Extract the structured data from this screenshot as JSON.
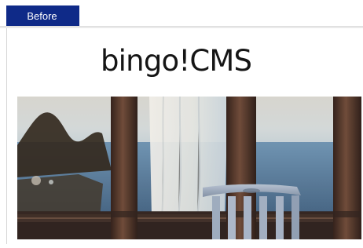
{
  "tab": {
    "label": "Before"
  },
  "brand": {
    "logo_text": "bingo!CMS"
  },
  "hero": {
    "icon": "window-chair-photo",
    "colors": {
      "wood": "#5a3b2a",
      "sky": "#c9d5d8",
      "sea": "#6e8fae",
      "chair": "#a7b4c6",
      "curtain": "#ece9e2"
    }
  }
}
